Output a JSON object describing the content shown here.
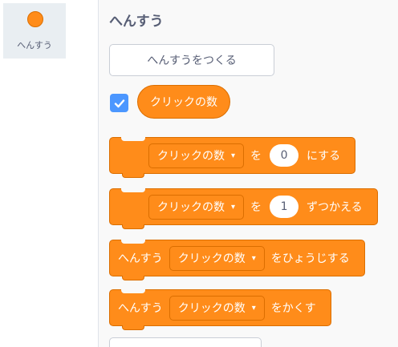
{
  "sidebar": {
    "category": {
      "label": "へんすう",
      "color": "#ff8c1a",
      "icon": "orange-circle-icon"
    }
  },
  "palette": {
    "title": "へんすう",
    "make_variable_label": "へんすうをつくる",
    "variable": {
      "name": "クリックの数",
      "checked": true
    },
    "blocks": {
      "set": {
        "variable": "クリックの数",
        "word_to": "を",
        "value": "0",
        "word_end": "にする"
      },
      "change": {
        "variable": "クリックの数",
        "word_by": "を",
        "value": "1",
        "word_end": "ずつかえる"
      },
      "show": {
        "prefix": "へんすう",
        "variable": "クリックの数",
        "word_end": "をひょうじする"
      },
      "hide": {
        "prefix": "へんすう",
        "variable": "クリックの数",
        "word_end": "をかくす"
      }
    },
    "dropdown_arrow": "▾",
    "colors": {
      "variables": "#ff8c1a",
      "variables_border": "#db6e00",
      "checkbox": "#4c97ff",
      "text_gray": "#575e75"
    }
  }
}
